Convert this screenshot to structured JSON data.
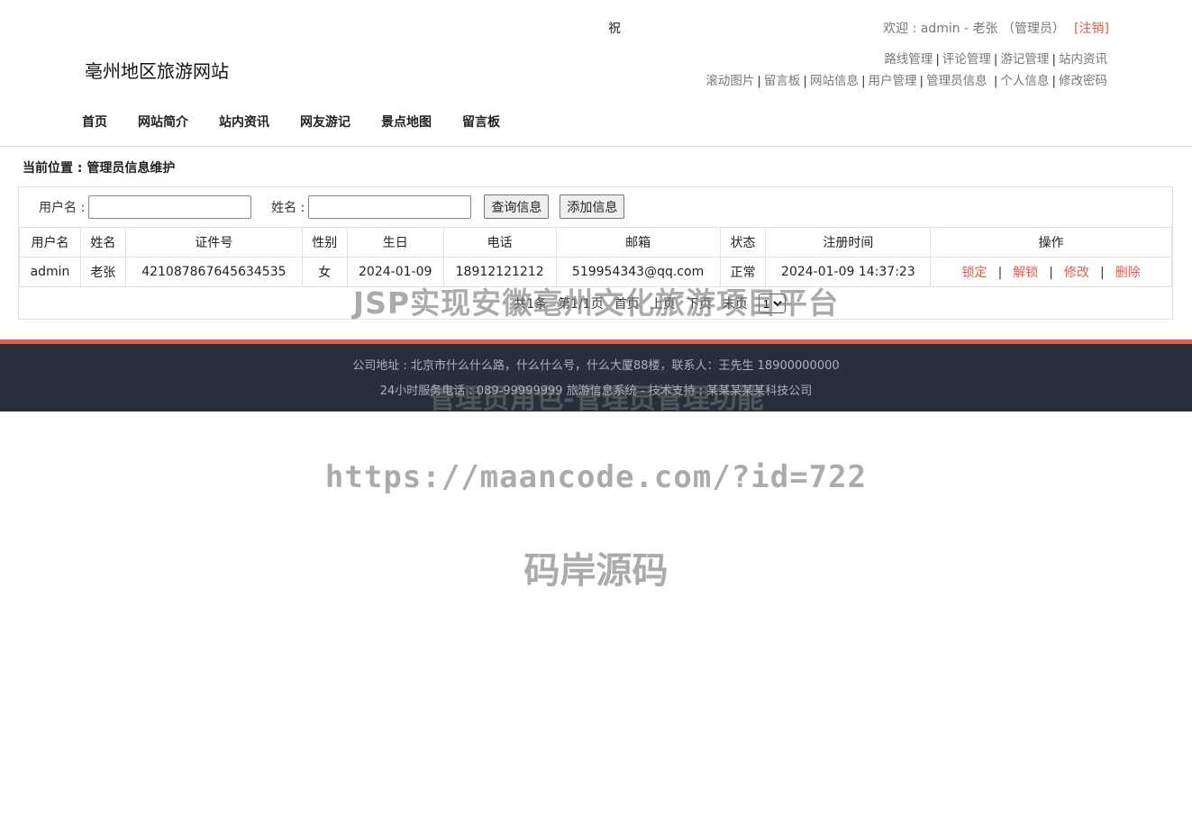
{
  "header": {
    "marquee": "祝",
    "welcome": "欢迎 : admin - 老张 （管理员）",
    "logout": "[注销]",
    "site_title": "亳州地区旅游网站",
    "admin_links_row1": [
      "路线管理",
      "评论管理",
      "游记管理",
      "站内资讯"
    ],
    "admin_links_row2": [
      "滚动图片",
      "留言板",
      "网站信息",
      "用户管理",
      "管理员信息",
      "个人信息",
      "修改密码"
    ],
    "nav": [
      "首页",
      "网站简介",
      "站内资讯",
      "网友游记",
      "景点地图",
      "留言板"
    ]
  },
  "breadcrumb": "当前位置 : 管理员信息维护",
  "search": {
    "username_label": "用户名 :",
    "name_label": "姓名 :",
    "username_value": "",
    "name_value": "",
    "query_button": "查询信息",
    "add_button": "添加信息"
  },
  "table": {
    "headers": [
      "用户名",
      "姓名",
      "证件号",
      "性别",
      "生日",
      "电话",
      "邮箱",
      "状态",
      "注册时间",
      "操作"
    ],
    "rows": [
      {
        "username": "admin",
        "name": "老张",
        "id_number": "421087867645634535",
        "gender": "女",
        "birthday": "2024-01-09",
        "phone": "18912121212",
        "email": "519954343@qq.com",
        "status": "正常",
        "registered": "2024-01-09 14:37:23",
        "ops": [
          "锁定",
          "解锁",
          "修改",
          "删除"
        ]
      }
    ]
  },
  "pager": {
    "total": "共1条",
    "page": "第1/1页",
    "first": "首页",
    "prev": "上页",
    "next": "下页",
    "last": "末页",
    "selected": "1"
  },
  "footer": {
    "line1": "公司地址 : 北京市什么什么路，什么什么号，什么大厦88楼，联系人：王先生 18900000000",
    "line2": "24小时服务电话 : 089-99999999   旅游信息系统 - 技术支持 : 某某某某某科技公司"
  },
  "watermarks": {
    "title": "JSP实现安徽亳州文化旅游项目平台",
    "subtitle": "管理员角色-管理员管理功能",
    "url": "https://maancode.com/?id=722",
    "brand": "码岸源码"
  },
  "colors": {
    "accent": "#e65c4c",
    "link_red": "#e45a4a",
    "footer_bg": "#272f3a"
  }
}
